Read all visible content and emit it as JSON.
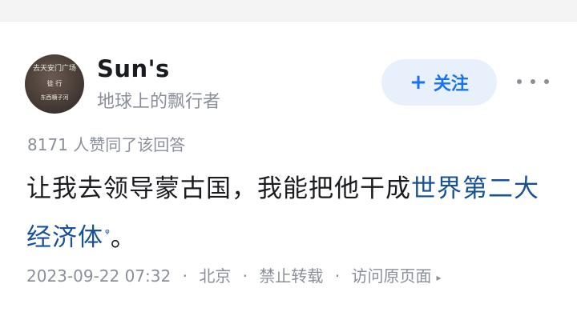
{
  "author": {
    "name": "Sun's",
    "bio": "地球上的飘行者",
    "avatar_text": [
      "去天安门广场",
      "徒 行",
      "东西横子河"
    ]
  },
  "follow": {
    "plus": "+",
    "label": "关注"
  },
  "more": {
    "icon": "more-dots-icon"
  },
  "upvotes": {
    "text": "8171 人赞同了该回答"
  },
  "answer": {
    "text_before": "让我去领导蒙古国，我能把他干成",
    "link_text": "世界第二大经济体",
    "search_icon": "ᵠ",
    "text_after": "。"
  },
  "meta": {
    "datetime": "2023-09-22 07:32",
    "separator": "·",
    "location": "北京",
    "copyright": "禁止转载",
    "visit_link": "访问原页面",
    "arrow": "▸"
  },
  "colors": {
    "accent": "#1772f6",
    "link": "#175199",
    "muted": "#8a8f99",
    "follow_bg": "#e8f0fb"
  }
}
